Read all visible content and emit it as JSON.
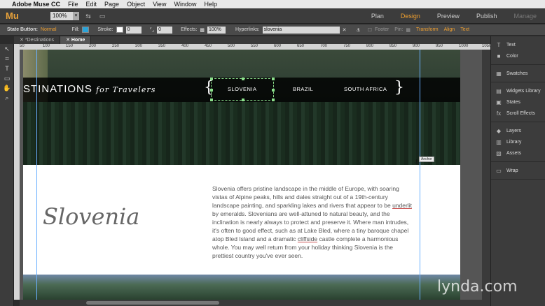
{
  "menubar": {
    "apple": "",
    "items": [
      "Adobe Muse CC",
      "File",
      "Edit",
      "Page",
      "Object",
      "View",
      "Window",
      "Help"
    ]
  },
  "appbar": {
    "logo": "Mu",
    "zoom": "100%",
    "modes": [
      "Plan",
      "Design",
      "Preview",
      "Publish",
      "Manage"
    ],
    "active_mode": "Design"
  },
  "options": {
    "state_button_label": "State Button:",
    "state_button_value": "Normal",
    "fill_label": "Fill:",
    "fill_color": "#2aa3d8",
    "stroke_label": "Stroke:",
    "stroke_value": "0",
    "corner_value": "0",
    "effects_label": "Effects:",
    "effects_value": "100%",
    "hyperlinks_label": "Hyperlinks:",
    "hyperlinks_value": "slovenia",
    "footer_label": "Footer",
    "pin_label": "Pin:",
    "transform_label": "Transform",
    "align_label": "Align",
    "text_label": "Text"
  },
  "tabs": [
    {
      "label": "*Destinations"
    },
    {
      "label": "Home"
    }
  ],
  "ruler": {
    "ticks": [
      "50",
      "100",
      "150",
      "200",
      "250",
      "300",
      "350",
      "400",
      "450",
      "500",
      "550",
      "600",
      "650",
      "700",
      "750",
      "800",
      "850",
      "900",
      "950",
      "1000",
      "1050",
      "1100"
    ]
  },
  "site": {
    "brand_main": "STINATIONS",
    "brand_sub": "for Travelers",
    "nav": [
      "SLOVENIA",
      "BRAZIL",
      "SOUTH AFRICA"
    ],
    "heading": "Slovenia",
    "para_before_1": "Slovenia offers pristine landscape in the middle of Europe, with soaring vistas of Alpine peaks, hills and dales straight out of a 19th-century landscape painting, and sparkling lakes and rivers that appear to be ",
    "para_link_1": "underlit",
    "para_mid": " by emeralds. Slovenians are well-attuned to natural beauty, and the inclination is nearly always to protect and preserve it. Where man intrudes, it's often to good effect, such as at Lake Bled, where a tiny baroque chapel atop Bled Island and a dramatic ",
    "para_link_2": "cliffside",
    "para_after": " castle complete a harmonious whole. You may well return from your holiday thinking Slovenia is the prettiest country you've ever seen."
  },
  "anchor_tooltip": "Anchor",
  "panels": [
    {
      "icon": "T",
      "label": "Text"
    },
    {
      "icon": "■",
      "label": "Color"
    },
    {
      "icon": "▦",
      "label": "Swatches"
    },
    {
      "icon": "▤",
      "label": "Widgets Library"
    },
    {
      "icon": "▣",
      "label": "States"
    },
    {
      "icon": "fx",
      "label": "Scroll Effects"
    },
    {
      "icon": "◆",
      "label": "Layers"
    },
    {
      "icon": "▥",
      "label": "Library"
    },
    {
      "icon": "▧",
      "label": "Assets"
    },
    {
      "icon": "▭",
      "label": "Wrap"
    }
  ],
  "watermark": {
    "text": "lynda",
    "dot": ".",
    "suffix": "com"
  }
}
